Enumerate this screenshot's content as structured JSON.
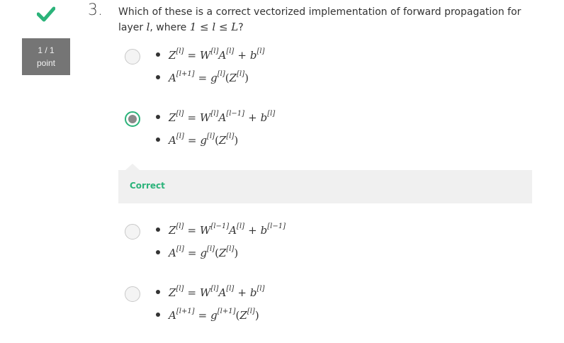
{
  "question": {
    "number": "3.",
    "text_prefix": "Which of these is a correct vectorized implementation of forward propagation for layer",
    "layer_var": "l",
    "text_where": ", where",
    "constraint": "1 ≤ l ≤ L",
    "text_suffix": "?"
  },
  "score": {
    "value": "1 / 1",
    "label": "point"
  },
  "status_color": "#2bb37a",
  "feedback": {
    "label": "Correct"
  },
  "options": [
    {
      "selected": false,
      "line1": {
        "lhs": "Z",
        "lhs_sup": "[l]",
        "w_sup": "[l]",
        "a_sup": "[l]",
        "b_sup": "[l]"
      },
      "line2": {
        "a_sup": "[l+1]",
        "g_sup": "[l]",
        "z_sup": "[l]"
      }
    },
    {
      "selected": true,
      "line1": {
        "lhs": "Z",
        "lhs_sup": "[l]",
        "w_sup": "[l]",
        "a_sup": "[l−1]",
        "b_sup": "[l]"
      },
      "line2": {
        "a_sup": "[l]",
        "g_sup": "[l]",
        "z_sup": "[l]"
      }
    },
    {
      "selected": false,
      "line1": {
        "lhs": "Z",
        "lhs_sup": "[l]",
        "w_sup": "[l−1]",
        "a_sup": "[l]",
        "b_sup": "[l−1]"
      },
      "line2": {
        "a_sup": "[l]",
        "g_sup": "[l]",
        "z_sup": "[l]"
      }
    },
    {
      "selected": false,
      "line1": {
        "lhs": "Z",
        "lhs_sup": "[l]",
        "w_sup": "[l]",
        "a_sup": "[l]",
        "b_sup": "[l]"
      },
      "line2": {
        "a_sup": "[l+1]",
        "g_sup": "[l+1]",
        "z_sup": "[l]"
      }
    }
  ]
}
